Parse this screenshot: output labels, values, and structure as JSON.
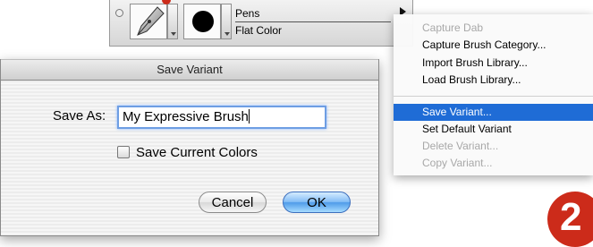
{
  "brush_bar": {
    "category_name": "Pens",
    "variant_name": "Flat Color"
  },
  "menu": {
    "items": [
      {
        "label": "Capture Dab",
        "state": "disabled"
      },
      {
        "label": "Capture Brush Category...",
        "state": "enabled"
      },
      {
        "label": "Import Brush Library...",
        "state": "enabled"
      },
      {
        "label": "Load Brush Library...",
        "state": "enabled"
      },
      {
        "label": "Save Variant...",
        "state": "selected"
      },
      {
        "label": "Set Default Variant",
        "state": "enabled"
      },
      {
        "label": "Delete Variant...",
        "state": "disabled"
      },
      {
        "label": "Copy Variant...",
        "state": "disabled"
      }
    ]
  },
  "dialog": {
    "title": "Save Variant",
    "save_as_label": "Save As:",
    "save_as_value": "My Expressive Brush",
    "checkbox_label": "Save Current Colors",
    "checkbox_checked": false,
    "cancel_label": "Cancel",
    "ok_label": "OK"
  },
  "step_badge": "2",
  "colors": {
    "selection": "#1f6cd6",
    "badge": "#cc2b1a",
    "default_button": "#4f9be9"
  }
}
